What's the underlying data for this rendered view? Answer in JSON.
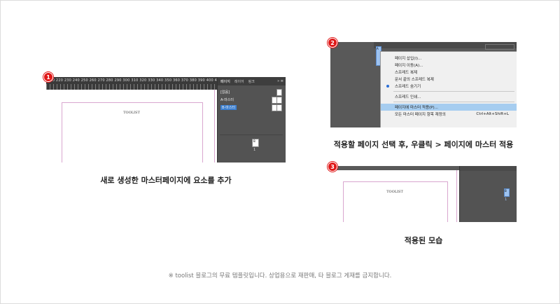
{
  "step1": {
    "badge": "1",
    "caption": "새로 생성한 마스터페이지에 요소를 추가",
    "ruler_numbers": "210  220  230  240  250  260  270  280  290  300  310  320  330  340  350  360  370  380  390  400  410  420  430",
    "canvas_text": "TOOLIST",
    "panel_tabs": [
      "페이지",
      "레이어",
      "링크"
    ],
    "panel_menu_icon": "»  ≡",
    "panel_items": [
      "[없음]",
      "A-마스터",
      "B-마스터"
    ],
    "selected_item": "B-마스터",
    "page_tag": "B",
    "page_number": "1"
  },
  "step2": {
    "badge": "2",
    "caption": "적용할 페이지 선택 후, 우클릭 > 페이지에 마스터 적용",
    "page_tag": "A",
    "menu": [
      {
        "label": "페이지 삽입(I)...",
        "shortcut": ""
      },
      {
        "label": "페이지 이동(A)...",
        "shortcut": ""
      },
      {
        "label": "스프레드 복제",
        "shortcut": ""
      },
      {
        "label": "문서 끝의 스프레드 복제",
        "shortcut": ""
      },
      {
        "label": "스프레드 숨기기",
        "shortcut": ""
      },
      {
        "label": "스프레드 인쇄...",
        "shortcut": ""
      },
      {
        "label": "페이지에 마스터 적용(P)...",
        "shortcut": ""
      },
      {
        "label": "모든 마스터 페이지 항목 재정의",
        "shortcut": "Ctrl+Alt+Shift+L"
      }
    ],
    "highlight_color": "#a6cdf0"
  },
  "step3": {
    "badge": "3",
    "caption": "적용된 모습",
    "canvas_text": "TOOLIST",
    "page_tag": "B",
    "page_number": "1"
  },
  "footer": "※ toolist 블로그의 무료 템플릿입니다. 상업용으로 재판매, 타 블로그 게재를 금지합니다.",
  "colors": {
    "badge": "#e01818",
    "ui_dark": "#595959",
    "selection_blue": "#3b7fd1",
    "margin_pink": "#d9a6cf"
  }
}
